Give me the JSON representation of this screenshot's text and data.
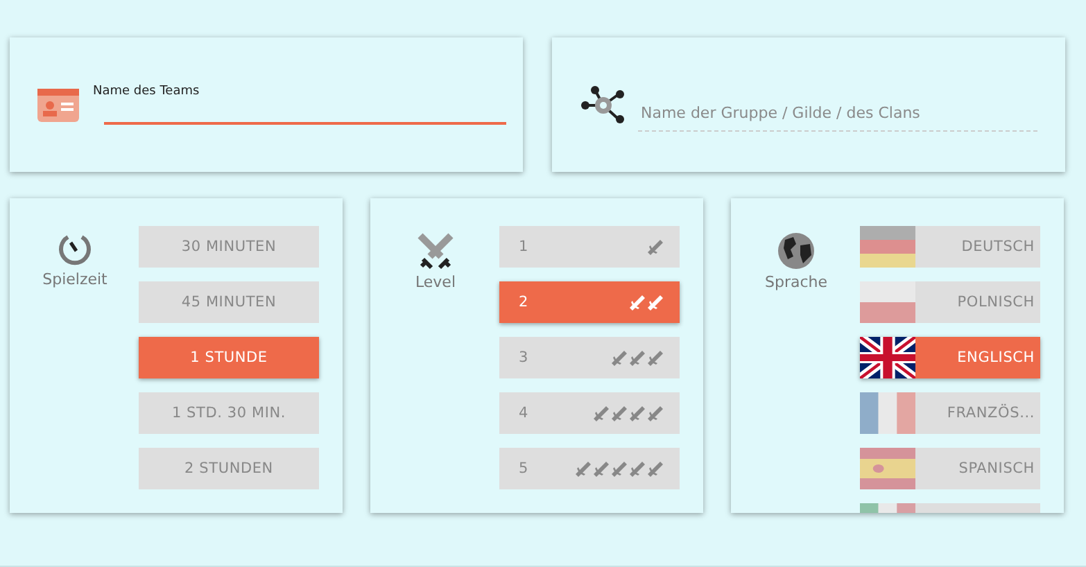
{
  "team_name": {
    "label": "Name des Teams"
  },
  "group_name": {
    "placeholder": "Name der Gruppe / Gilde / des Clans"
  },
  "playtime": {
    "label": "Spielzeit",
    "options": [
      {
        "label": "30 MINUTEN",
        "selected": false
      },
      {
        "label": "45 MINUTEN",
        "selected": false
      },
      {
        "label": "1 STUNDE",
        "selected": true
      },
      {
        "label": "1 STD. 30 MIN.",
        "selected": false
      },
      {
        "label": "2 STUNDEN",
        "selected": false
      }
    ]
  },
  "level": {
    "label": "Level",
    "options": [
      {
        "label": "1",
        "selected": false
      },
      {
        "label": "2",
        "selected": true
      },
      {
        "label": "3",
        "selected": false
      },
      {
        "label": "4",
        "selected": false
      },
      {
        "label": "5",
        "selected": false
      }
    ]
  },
  "language": {
    "label": "Sprache",
    "options": [
      {
        "label": "DEUTSCH",
        "kind": "de",
        "selected": false
      },
      {
        "label": "POLNISCH",
        "kind": "pl",
        "selected": false
      },
      {
        "label": "ENGLISCH",
        "kind": "gb",
        "selected": true
      },
      {
        "label": "FRANZÖS...",
        "kind": "fr",
        "selected": false
      },
      {
        "label": "SPANISCH",
        "kind": "es",
        "selected": false
      },
      {
        "kind": "it",
        "selected": false
      }
    ]
  }
}
